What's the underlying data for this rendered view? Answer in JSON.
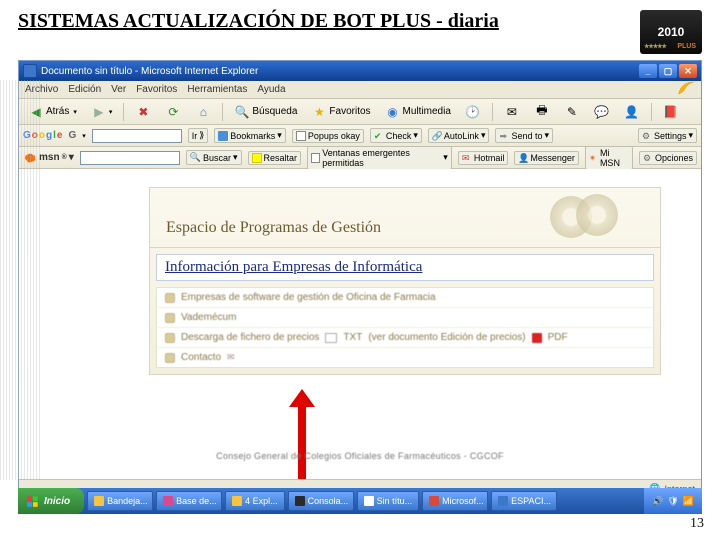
{
  "slide": {
    "title": "SISTEMAS ACTUALIZACIÓN DE BOT PLUS - diaria",
    "page_num": "13"
  },
  "badge": {
    "year": "2010",
    "plus": "PLUS"
  },
  "ie": {
    "title": "Documento sin título - Microsoft Internet Explorer",
    "menus": [
      "Archivo",
      "Edición",
      "Ver",
      "Favoritos",
      "Herramientas",
      "Ayuda"
    ],
    "nav": {
      "back": "Atrás",
      "search": "Búsqueda",
      "favorites": "Favoritos",
      "media": "Multimedia"
    }
  },
  "google": {
    "go": "Ir",
    "bookmarks": "Bookmarks",
    "popups": "Popups okay",
    "check": "Check",
    "autolink": "AutoLink",
    "sendto": "Send to",
    "settings": "Settings"
  },
  "msn": {
    "label": "msn",
    "search": "Buscar",
    "highlight": "Resaltar",
    "blocked": "Ventanas emergentes permitidas",
    "hotmail": "Hotmail",
    "messenger": "Messenger",
    "mimsn": "Mi MSN",
    "options": "Opciones"
  },
  "panel": {
    "heading": "Espacio de Programas de Gestión",
    "subheading": "Información para Empresas de Informática",
    "rows": {
      "r1": "Empresas de software de gestión de Oficina de Farmacia",
      "r2": "Vademécum",
      "r3_a": "Descarga de fichero de precios",
      "r3_txt": "TXT",
      "r3_b": "(ver documento Edición de precios)",
      "r3_pdf": "PDF",
      "r4": "Contacto"
    },
    "footer": "Consejo General de Colegios Oficiales de Farmacéuticos - CGCOF"
  },
  "status": {
    "zone": "Internet"
  },
  "taskbar": {
    "start": "Inicio",
    "tasks": [
      "Bandeja...",
      "Base de...",
      "4 Expl...",
      "Consola...",
      "Sin títu...",
      "Microsof...",
      "ESPACI..."
    ]
  }
}
